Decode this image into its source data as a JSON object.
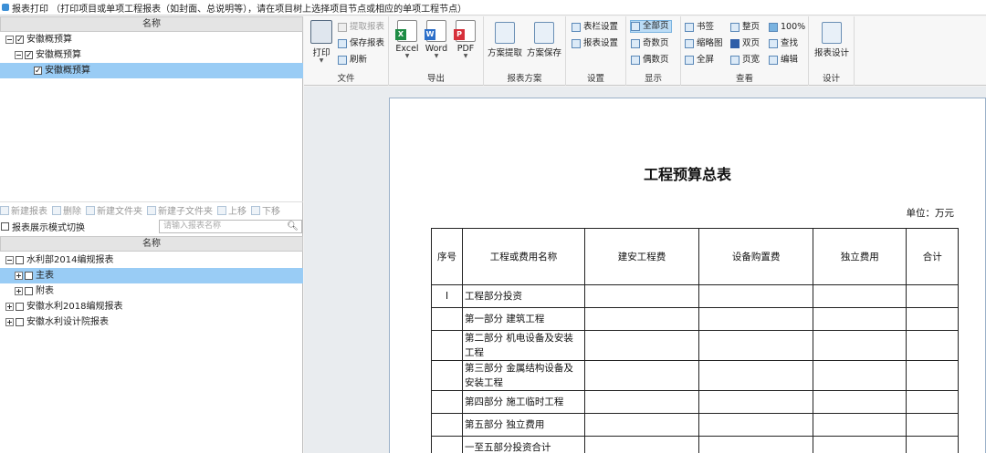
{
  "title_bar": "报表打印 （打印项目或单项工程报表（如封面、总说明等），请在项目树上选择项目节点或相应的单项工程节点）",
  "project_tree": {
    "header": "名称",
    "items": [
      {
        "label": "安徽概预算",
        "level": 0,
        "expand": "minus",
        "checked": true,
        "selected": false
      },
      {
        "label": "安徽概预算",
        "level": 1,
        "expand": "minus",
        "checked": true,
        "selected": false
      },
      {
        "label": "安徽概预算",
        "level": 2,
        "expand": "",
        "checked": true,
        "selected": true
      }
    ]
  },
  "report_toolbar": {
    "new_report": "新建报表",
    "delete": "删除",
    "new_folder": "新建文件夹",
    "new_subfolder": "新建子文件夹",
    "move_up": "上移",
    "move_down": "下移"
  },
  "mode_switch_label": "报表展示模式切换",
  "search": {
    "placeholder": "请输入报表名称"
  },
  "report_tree": {
    "header": "名称",
    "items": [
      {
        "label": "水利部2014编规报表",
        "level": 0,
        "expand": "minus",
        "selected": false
      },
      {
        "label": "主表",
        "level": 1,
        "expand": "plus",
        "selected": true
      },
      {
        "label": "附表",
        "level": 1,
        "expand": "plus",
        "selected": false
      },
      {
        "label": "安徽水利2018编规报表",
        "level": 0,
        "expand": "plus",
        "selected": false
      },
      {
        "label": "安徽水利设计院报表",
        "level": 0,
        "expand": "plus",
        "selected": false
      }
    ]
  },
  "ribbon": {
    "file": {
      "print": "打印",
      "extract": "提取报表",
      "save": "保存报表",
      "refresh": "刷新",
      "label": "文件"
    },
    "export": {
      "excel": "Excel",
      "word": "Word",
      "pdf": "PDF",
      "label": "导出"
    },
    "scheme": {
      "extract": "方案提取",
      "save": "方案保存",
      "label": "报表方案"
    },
    "settings": {
      "column": "表栏设置",
      "report": "报表设置",
      "label": "设置"
    },
    "display": {
      "all": "全部页",
      "odd": "奇数页",
      "even": "偶数页",
      "label": "显示"
    },
    "view": {
      "bookmark": "书签",
      "thumbnail": "缩略图",
      "fullscreen": "全屏",
      "whole": "整页",
      "double": "双页",
      "pagewidth": "页宽",
      "zoom": "100%",
      "find": "查找",
      "edit": "编辑",
      "label": "查看"
    },
    "design": {
      "report_design": "报表设计",
      "label": "设计"
    }
  },
  "document": {
    "title": "工程预算总表",
    "unit": "单位：万元",
    "headers": [
      "序号",
      "工程或费用名称",
      "建安工程费",
      "设备购置费",
      "独立费用",
      "合计"
    ],
    "rows": [
      [
        "Ⅰ",
        "工程部分投资",
        "",
        "",
        "",
        ""
      ],
      [
        "",
        "第一部分  建筑工程",
        "",
        "",
        "",
        ""
      ],
      [
        "",
        "第二部分  机电设备及安装工程",
        "",
        "",
        "",
        ""
      ],
      [
        "",
        "第三部分  金属结构设备及安装工程",
        "",
        "",
        "",
        ""
      ],
      [
        "",
        "第四部分  施工临时工程",
        "",
        "",
        "",
        ""
      ],
      [
        "",
        "第五部分  独立费用",
        "",
        "",
        "",
        ""
      ],
      [
        "",
        "一至五部分投资合计",
        "",
        "",
        "",
        ""
      ]
    ]
  }
}
